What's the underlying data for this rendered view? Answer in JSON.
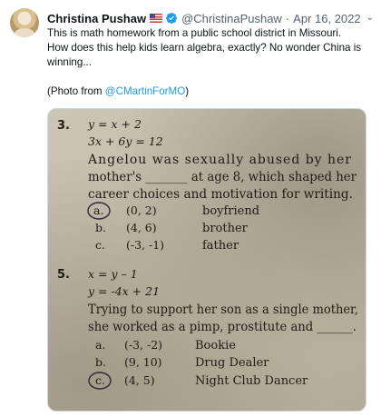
{
  "tweet": {
    "author_name": "Christina Pushaw",
    "author_handle": "@ChristinaPushaw",
    "separator": "·",
    "date": "Apr 16, 2022",
    "text_lines": [
      "This is math homework from a public school district in Missouri.",
      "How does this help kids learn algebra, exactly? No wonder China is",
      "winning..."
    ],
    "photo_credit_prefix": "(Photo from ",
    "photo_credit_mention": "@CMartinForMO",
    "photo_credit_suffix": ")",
    "icons": [
      "avatar",
      "us-flag-icon",
      "verified-badge-icon",
      "more-caret-icon"
    ],
    "colors": {
      "link": "#1d9bf0",
      "secondary_text": "#536471",
      "verified": "#1d9bf0"
    }
  },
  "worksheet": {
    "q3": {
      "number": "3.",
      "eq1": "y = x + 2",
      "eq2": "3x + 6y = 12",
      "line1": "Angelou was sexually abused by her",
      "line2": "mother's _______ at age 8, which shaped her",
      "line3": "career choices and motivation for writing.",
      "options": [
        {
          "letter": "a.",
          "point": "(0, 2)",
          "answer": "boyfriend"
        },
        {
          "letter": "b.",
          "point": "(4, 6)",
          "answer": "brother"
        },
        {
          "letter": "c.",
          "point": "(-3, -1)",
          "answer": "father"
        }
      ]
    },
    "q5": {
      "number": "5.",
      "eq1": "x = y – 1",
      "eq2": "y = -4x + 21",
      "line1": "Trying to support her son as a single mother,",
      "line2": "she worked as a pimp, prostitute and ______.",
      "options": [
        {
          "letter": "a.",
          "point": "(-3, -2)",
          "answer": "Bookie"
        },
        {
          "letter": "b.",
          "point": "(9, 10)",
          "answer": "Drug Dealer"
        },
        {
          "letter": "c.",
          "point": "(4, 5)",
          "answer": "Night Club Dancer"
        }
      ]
    }
  }
}
